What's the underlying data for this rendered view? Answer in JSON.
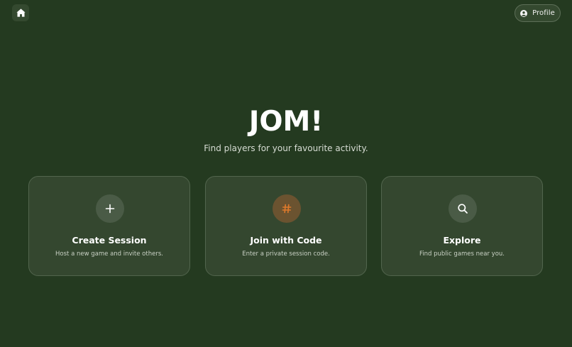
{
  "header": {
    "home_icon": "home-icon",
    "profile": {
      "label": "Profile",
      "icon": "user-circle-icon"
    }
  },
  "hero": {
    "title": "JOM!",
    "subtitle": "Find players for your favourite activity."
  },
  "cards": [
    {
      "title": "Create Session",
      "description": "Host a new game and invite others.",
      "icon": "plus-icon"
    },
    {
      "title": "Join with Code",
      "description": "Enter a private session code.",
      "icon": "hash-icon"
    },
    {
      "title": "Explore",
      "description": "Find public games near you.",
      "icon": "search-icon"
    }
  ],
  "colors": {
    "background": "#243a20",
    "card": "#34472f",
    "card_border": "#52654d",
    "accent": "#e07a2b"
  }
}
